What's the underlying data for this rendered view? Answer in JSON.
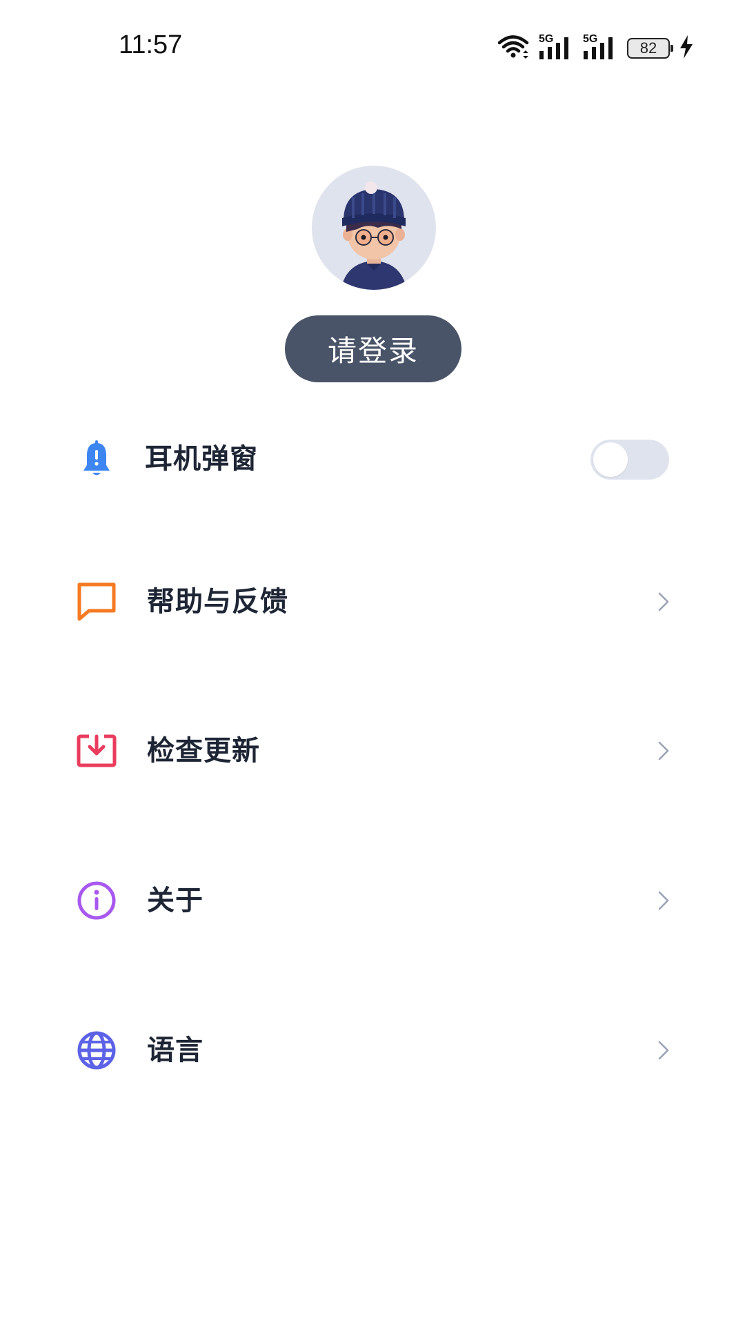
{
  "status_bar": {
    "time": "11:57",
    "battery_level": "82",
    "network_1": "5G",
    "network_2": "5G",
    "icons": [
      "wifi-icon",
      "signal-5g-icon",
      "signal-5g-icon",
      "battery-icon",
      "charging-bolt-icon"
    ]
  },
  "profile": {
    "login_label": "请登录"
  },
  "menu": {
    "items": [
      {
        "label": "耳机弹窗",
        "icon": "bell-alert-icon",
        "icon_color": "#3d86f2",
        "control": "toggle",
        "toggle_on": false
      },
      {
        "label": "帮助与反馈",
        "icon": "chat-bubble-icon",
        "icon_color": "#f57a22",
        "control": "chevron"
      },
      {
        "label": "检查更新",
        "icon": "download-tray-icon",
        "icon_color": "#ea3d5e",
        "control": "chevron"
      },
      {
        "label": "关于",
        "icon": "info-circle-icon",
        "icon_color": "#a858ef",
        "control": "chevron"
      },
      {
        "label": "语言",
        "icon": "globe-icon",
        "icon_color": "#5d63e6",
        "control": "chevron"
      }
    ]
  },
  "colors": {
    "login_button_bg": "#4a5468",
    "toggle_off_bg": "#dfe3ee",
    "chevron": "#9aa3b5",
    "text_primary": "#1e2535"
  }
}
